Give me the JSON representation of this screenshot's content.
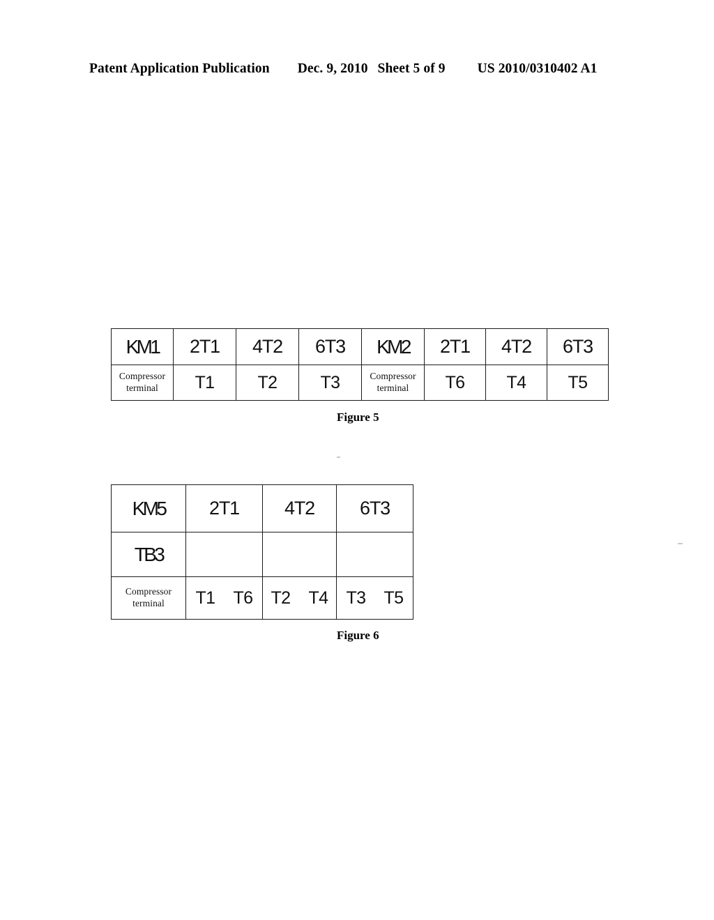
{
  "header": {
    "publication_title": "Patent Application Publication",
    "date": "Dec. 9, 2010",
    "sheet": "Sheet 5 of 9",
    "publication_number": "US 2010/0310402 A1"
  },
  "figure5": {
    "caption": "Figure 5",
    "columns": 8,
    "rows": [
      {
        "type": "header",
        "cells": [
          "KM1",
          "2T1",
          "4T2",
          "6T3",
          "KM2",
          "2T1",
          "4T2",
          "6T3"
        ]
      },
      {
        "type": "data",
        "cells": [
          "Compressor terminal",
          "T1",
          "T2",
          "T3",
          "Compressor terminal",
          "T6",
          "T4",
          "T5"
        ]
      }
    ],
    "label_line1": "Compressor",
    "label_line2": "terminal"
  },
  "figure6": {
    "caption": "Figure 6",
    "columns": 4,
    "rows": [
      {
        "type": "header",
        "cells": [
          "KM5",
          "2T1",
          "4T2",
          "6T3"
        ]
      },
      {
        "type": "blank",
        "cells": [
          "TB3",
          "",
          "",
          ""
        ]
      },
      {
        "type": "data",
        "cells": [
          "Compressor terminal",
          "T1 T6",
          "T2 T4",
          "T3 T5"
        ]
      }
    ],
    "label_line1": "Compressor",
    "label_line2": "terminal",
    "terminal_pairs": [
      [
        "T1",
        "T6"
      ],
      [
        "T2",
        "T4"
      ],
      [
        "T3",
        "T5"
      ]
    ]
  },
  "colors": {
    "page_background": "#ffffff",
    "ink": "#111111",
    "rule": "#1b1b1b"
  }
}
